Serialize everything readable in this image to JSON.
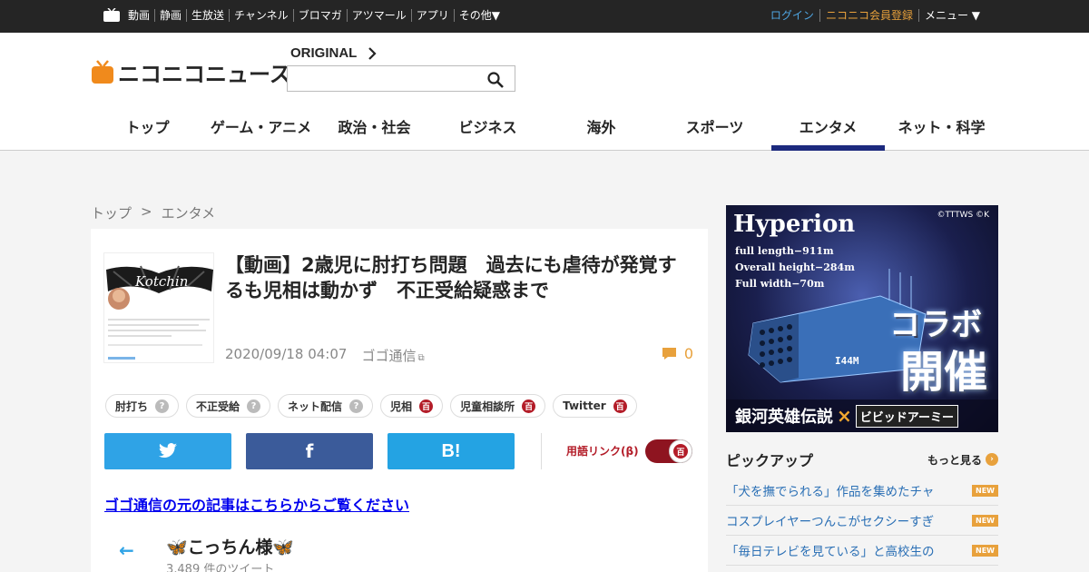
{
  "topbar": {
    "nav": [
      "動画",
      "静画",
      "生放送",
      "チャンネル",
      "ブロマガ",
      "アツマール",
      "アプリ",
      "その他▼"
    ],
    "login": "ログイン",
    "register": "ニコニコ会員登録",
    "menu": "メニュー ▼"
  },
  "header": {
    "logo_text": "ニコニコニュース",
    "original": "ORIGINAL",
    "search_placeholder": "",
    "categories": [
      "トップ",
      "ゲーム・アニメ",
      "政治・社会",
      "ビジネス",
      "海外",
      "スポーツ",
      "エンタメ",
      "ネット・科学"
    ],
    "active_category": "エンタメ"
  },
  "breadcrumb": [
    "トップ",
    ">",
    "エンタメ"
  ],
  "article": {
    "title": "【動画】2歳児に肘打ち問題　過去にも虐待が発覚するも児相は動かず　不正受給疑惑まで",
    "date": "2020/09/18 04:07",
    "source": "ゴゴ通信",
    "comment_count": "0",
    "tags": [
      {
        "label": "肘打ち",
        "kind": "q"
      },
      {
        "label": "不正受給",
        "kind": "q"
      },
      {
        "label": "ネット配信",
        "kind": "q"
      },
      {
        "label": "児相",
        "kind": "d"
      },
      {
        "label": "児童相談所",
        "kind": "d"
      },
      {
        "label": "Twitter",
        "kind": "d"
      }
    ],
    "tag_q_mark": "?",
    "tag_d_mark": "百",
    "share": {
      "twitter": "",
      "facebook": "f",
      "hatena": "B!"
    },
    "term_link_label": "用語リンク(β)",
    "original_link": "ゴゴ通信の元の記事はこちらからご覧ください",
    "embed": {
      "back": "←",
      "name": "🦋こっちん様🦋",
      "tweets": "3,489 件のツイート"
    },
    "thumb_text": "Kotchin"
  },
  "ad": {
    "title": "Hyperion",
    "copyright": "©TTTWS ©K",
    "specs": [
      "full length−911m",
      "Overall height−284m",
      "Full width−70m"
    ],
    "collab": "コラボ",
    "kaisai": "開催",
    "series": "銀河英雄伝説",
    "x": "×",
    "vivid": "ビビッドアーミー",
    "ship_label": "I44M"
  },
  "pickup": {
    "heading": "ピックアップ",
    "more": "もっと見る",
    "more_icon": "›",
    "items": [
      {
        "title": "「犬を撫でられる」作品を集めたチャ",
        "badge": "NEW"
      },
      {
        "title": "コスプレイヤーつんこがセクシーすぎ",
        "badge": "NEW"
      },
      {
        "title": "「毎日テレビを見ている」と高校生の",
        "badge": "NEW"
      }
    ]
  },
  "colors": {
    "topbar": "#252525",
    "accent_orange": "#e8a13c",
    "active_nav": "#1c2a7e",
    "twitter": "#2fa3e6",
    "facebook": "#3b5b9a",
    "hatena": "#24a3e3",
    "dic_red": "#b31c28"
  }
}
